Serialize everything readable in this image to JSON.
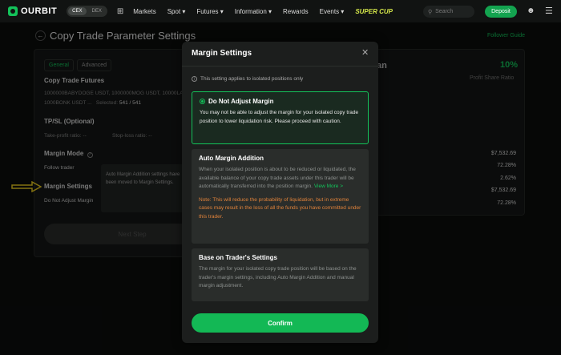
{
  "nav": {
    "logo": "OURBIT",
    "cex": "CEX",
    "dex": "DEX",
    "items": [
      "Markets",
      "Spot ▾",
      "Futures ▾",
      "Information ▾",
      "Rewards",
      "Events ▾"
    ],
    "super_cup": "SUPER CUP",
    "search_placeholder": "Search",
    "deposit": "Deposit"
  },
  "header": {
    "title": "Copy Trade Parameter Settings",
    "follower_guide": "Follower Guide"
  },
  "left_panel": {
    "tabs": [
      "General",
      "Advanced"
    ],
    "copy_trade_futures": "Copy Trade Futures",
    "pairs_line1": "1000000BABYDOGE USDT, 1000000MOG USDT, 10000LAD",
    "pairs_line2": "1000BONK USDT ...",
    "selected_label": "Selected:",
    "selected_value": "541 / 541",
    "tpsl_label": "TP/SL (Optional)",
    "take_profit": "Take-profit ratio: --",
    "stop_loss": "Stop-loss ratio: --",
    "margin_mode_label": "Margin Mode",
    "follow_trader": "Follow trader",
    "margin_settings_label": "Margin Settings",
    "margin_settings_value": "Do Not Adjust Margin",
    "tooltip": "Auto Margin Addition settings have been moved to Margin Settings.",
    "next_step": "Next Step"
  },
  "right_panel": {
    "name_partial": "an",
    "profit_share_value": "10%",
    "profit_share_label": "Profit Share Ratio",
    "values": [
      "$7,532.69",
      "72.28%",
      "2.62%",
      "$7,532.69",
      "72.28%"
    ]
  },
  "modal": {
    "title": "Margin Settings",
    "notice": "This setting applies to isolated positions only",
    "options": [
      {
        "title": "Do Not Adjust Margin",
        "desc": "You may not be able to adjust the margin for your isolated copy trade position to lower liquidation risk. Please proceed with caution.",
        "selected": true
      },
      {
        "title": "Auto Margin Addition",
        "desc": "When your isolated position is about to be reduced or liquidated, the available balance of your copy trade assets under this trader will be automatically transferred into the position margin.",
        "link": "View More >",
        "note": "Note: This will reduce the probability of liquidation, but in extreme cases may result in the loss of all the funds you have committed under this trader.",
        "selected": false
      },
      {
        "title": "Base on Trader's Settings",
        "desc": "The margin for your isolated copy trade position will be based on the trader's margin settings, including Auto Margin Addition and manual margin adjustment.",
        "selected": false
      }
    ],
    "confirm": "Confirm"
  },
  "colors": {
    "accent": "#13c35a",
    "warning": "#e0823a",
    "arrow": "#f0d020"
  }
}
